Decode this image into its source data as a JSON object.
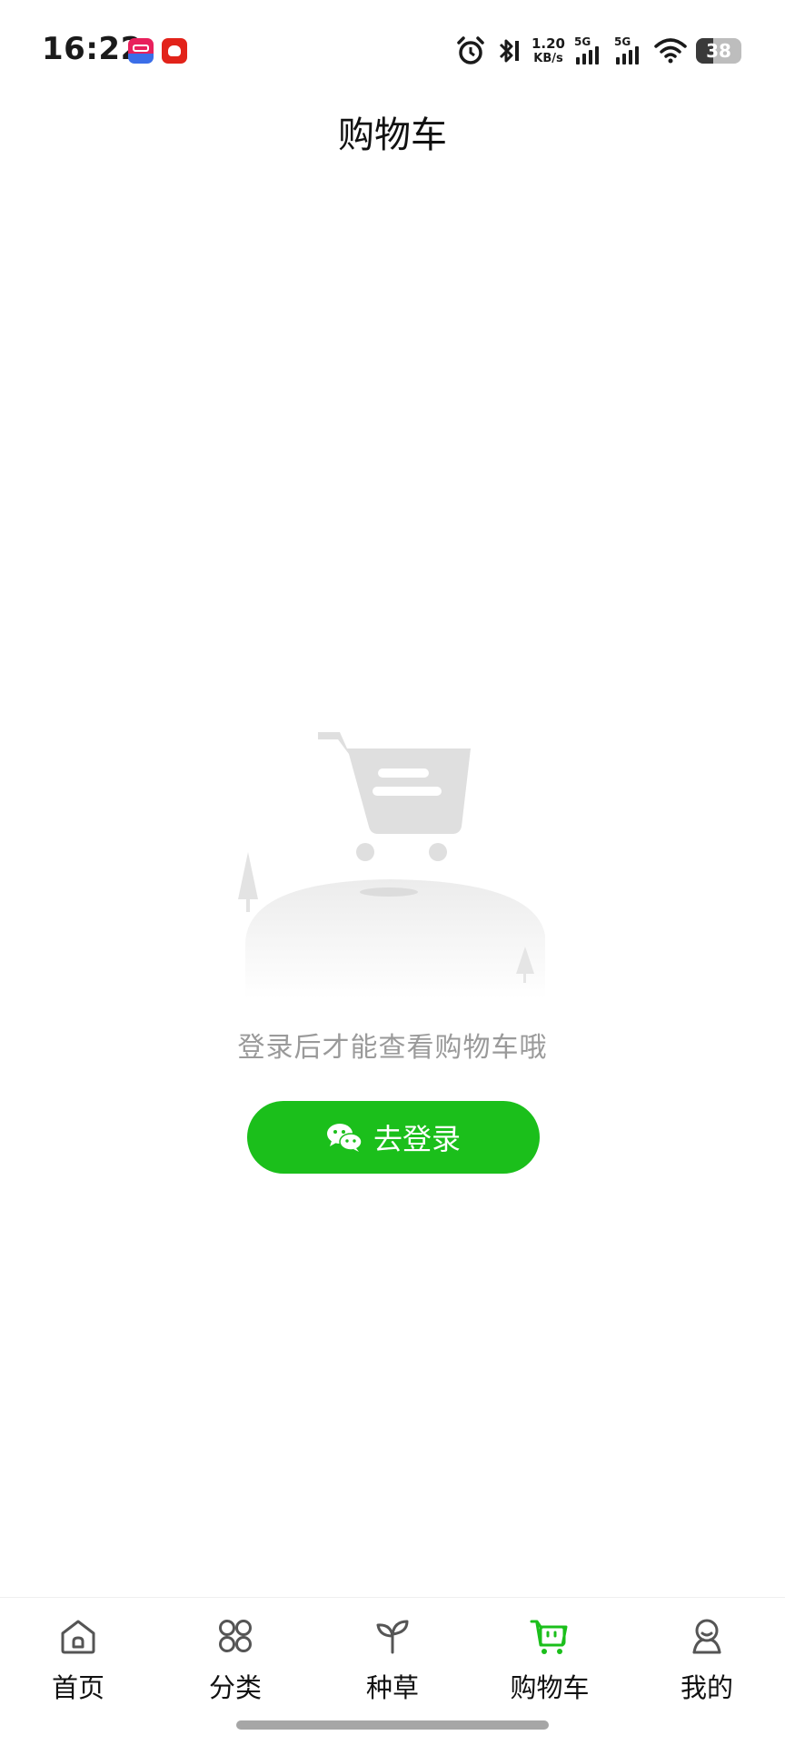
{
  "status_bar": {
    "time": "16:22",
    "net_speed_value": "1.20",
    "net_speed_unit": "KB/s",
    "signal1_label": "5G",
    "signal2_label": "5G",
    "battery": "38",
    "icons": [
      "alarm-icon",
      "bluetooth-icon",
      "wifi-icon"
    ]
  },
  "header": {
    "title": "购物车"
  },
  "empty_state": {
    "message": "登录后才能查看购物车哦",
    "login_button": "去登录",
    "button_icon": "wechat-icon"
  },
  "tabbar": {
    "tabs": [
      {
        "label": "首页",
        "icon": "home-icon"
      },
      {
        "label": "分类",
        "icon": "category-grid-icon"
      },
      {
        "label": "种草",
        "icon": "sprout-icon"
      },
      {
        "label": "购物车",
        "icon": "cart-icon",
        "active": true
      },
      {
        "label": "我的",
        "icon": "profile-icon"
      }
    ]
  },
  "colors": {
    "accent": "#1bbf1b",
    "active_tab": "#1bbf1b",
    "muted_text": "#9a9a9a",
    "illustration_gray": "#e0e0e0"
  }
}
